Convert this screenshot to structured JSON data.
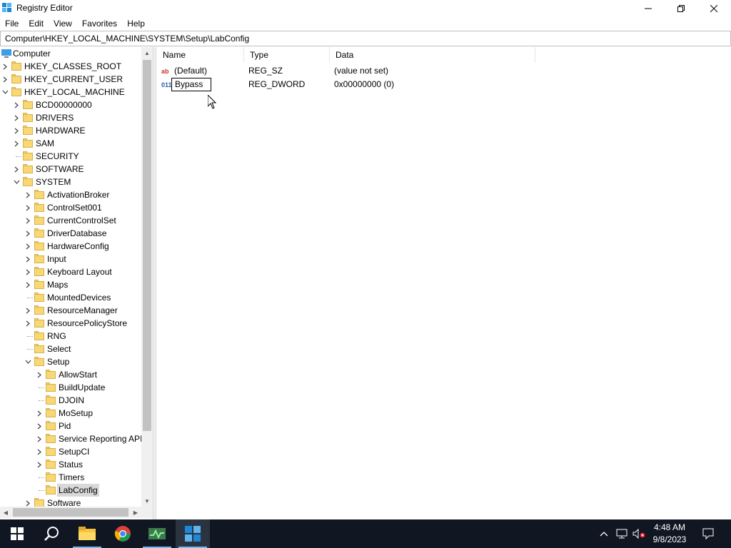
{
  "window": {
    "title": "Registry Editor",
    "menu": [
      "File",
      "Edit",
      "View",
      "Favorites",
      "Help"
    ],
    "address": "Computer\\HKEY_LOCAL_MACHINE\\SYSTEM\\Setup\\LabConfig"
  },
  "tree": {
    "root": "Computer",
    "hives": [
      "HKEY_CLASSES_ROOT",
      "HKEY_CURRENT_USER",
      "HKEY_LOCAL_MACHINE"
    ],
    "hklm_children": [
      "BCD00000000",
      "DRIVERS",
      "HARDWARE",
      "SAM",
      "SECURITY",
      "SOFTWARE",
      "SYSTEM"
    ],
    "system_children": [
      "ActivationBroker",
      "ControlSet001",
      "CurrentControlSet",
      "DriverDatabase",
      "HardwareConfig",
      "Input",
      "Keyboard Layout",
      "Maps",
      "MountedDevices",
      "ResourceManager",
      "ResourcePolicyStore",
      "RNG",
      "Select",
      "Setup"
    ],
    "setup_children": [
      "AllowStart",
      "BuildUpdate",
      "DJOIN",
      "MoSetup",
      "Pid",
      "Service Reporting API",
      "SetupCI",
      "Status",
      "Timers",
      "LabConfig"
    ],
    "after_setup": "Software",
    "selected": "LabConfig"
  },
  "list": {
    "columns": [
      "Name",
      "Type",
      "Data"
    ],
    "rows": [
      {
        "name": "(Default)",
        "type": "REG_SZ",
        "data": "(value not set)",
        "icon": "ab"
      },
      {
        "name": "Bypass",
        "type": "REG_DWORD",
        "data": "0x00000000 (0)",
        "icon": "011"
      }
    ],
    "renaming": "Bypass"
  },
  "taskbar": {
    "time": "4:48 AM",
    "date": "9/8/2023",
    "apps": [
      "start-icon",
      "search-icon",
      "file-explorer-icon",
      "chrome-icon",
      "task-manager-icon",
      "registry-editor-icon"
    ]
  }
}
